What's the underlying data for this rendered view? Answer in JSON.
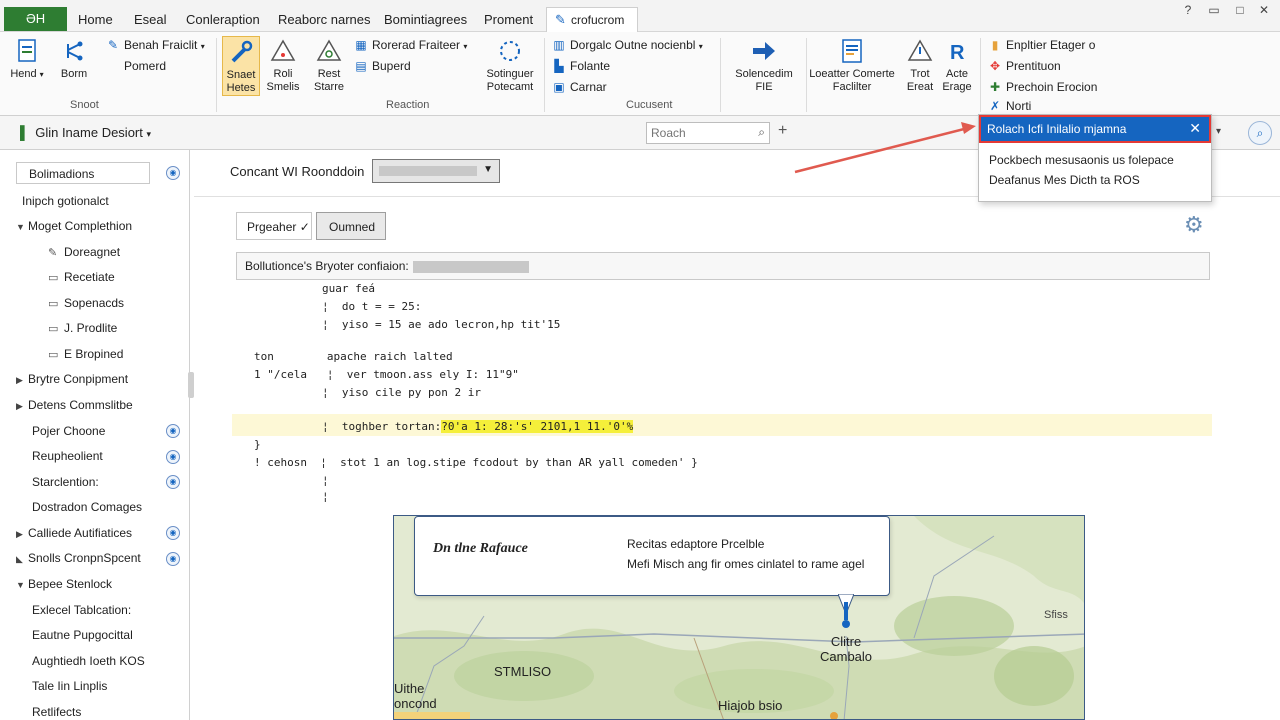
{
  "tabs": {
    "file": "ƏH",
    "items": [
      "Home",
      "Eseal",
      "Conleraption",
      "Reaborc narnes",
      "Bomintiagrees",
      "Proment"
    ],
    "active": "crofucrom"
  },
  "ribbon": {
    "btn_hend": "Hend",
    "btn_borm": "Borm",
    "link_benah": "Benah Fraiclit",
    "link_pomerd": "Pomerd",
    "group_snoot": "Snoot",
    "btn_snaet": "Snaet Hetes",
    "btn_roli": "Roli Smelis",
    "btn_rest": "Rest Starre",
    "link_rorerad": "Rorerad Fraiteer",
    "link_buperd": "Buperd",
    "btn_sotinguer": "Sotinguer Potecamt",
    "group_reaction": "Reaction",
    "link_dorgalc": "Dorgalc Outne nocienbl",
    "link_folante": "Folante",
    "link_carnar": "Carnar",
    "group_cucusent": "Cucusent",
    "btn_solencedim": "Solencedim FIE",
    "btn_loeatter": "Loeatter Comerte Faclilter",
    "btn_trot": "Trot Ereat",
    "btn_acte": "Acte Erage",
    "link_enpltier": "Enpltier Etager o",
    "link_prentituon": "Prentituon",
    "link_prechoin": "Prechoin Erocion",
    "link_norti": "Norti"
  },
  "cmdbar": {
    "doc_title": "Glin Iname Desiort",
    "search_placeholder": "Roach"
  },
  "popup": {
    "header": "Rolach Icfi Inilalio mjamna",
    "item1": "Pockbech mesusaonis us folepace",
    "item2": "Deafanus Mes Dicth ta ROS"
  },
  "sidebar": {
    "header": "Bolimadions",
    "items": [
      "Inipch gotionalct",
      "Moget Complethion",
      "Doreagnet",
      "Recetiate",
      "Sopenacds",
      "J. Prodlite",
      "E Bropined",
      "Brytre Conpipment",
      "Detens Commslitbe",
      "Pojer Choone",
      "Reupheolient",
      "Starclention:",
      "Dostradon Comages",
      "Calliede Autifiatices",
      "Snolls CronpnSpcent",
      "Bepee Stenlock",
      "Exlecel Tablcation:",
      "Eautne Pupgocittal",
      "Aughtiedh Ioeth KOS",
      "Tale Iin Linplis",
      "Retlifects"
    ]
  },
  "main": {
    "concept_label": "Concant WI Roonddoin",
    "btn_pregeher": "Prgeaher ✓",
    "btn_oumned": "Oumned",
    "config_label": "Bollutionce's Bryoter confiaion:",
    "code": [
      "guar feá",
      "¦  do t = = 25:",
      "¦  yiso = 15 ae ado lecron,hp tit'15",
      "ton        apache raich lalted",
      "1 \"/cela   ¦  ver tmoon.ass ely I: 11\"9\"",
      "¦  yiso cile py pon 2 ir",
      "¦  toghber tortan:",
      "?0'a 1: 28:'s' 2101,1 11.'0'%",
      "}",
      "! cehosn  ¦  stot 1 an log.stipe fcodout by than AR yall comeden' }",
      "¦",
      "¦"
    ]
  },
  "map": {
    "callout_title": "Dn tlne Rafauce",
    "callout_line1": "Recitas edaptore Prcelble",
    "callout_line2": "Mefi Misch ang fir omes cinlatel to rame agel",
    "label_clitre": "Clitre\nCambalo",
    "label_stmliso": "STMLISO",
    "label_hiajob": "Hiajob bsio",
    "label_uithe": "Uithe\noncond",
    "label_sfiss": "Sfiss"
  },
  "icons": {
    "hend": "document-icon",
    "borm": "branch-icon",
    "snaet": "wrench-icon",
    "gear": "gear-icon",
    "search": "search-icon"
  }
}
